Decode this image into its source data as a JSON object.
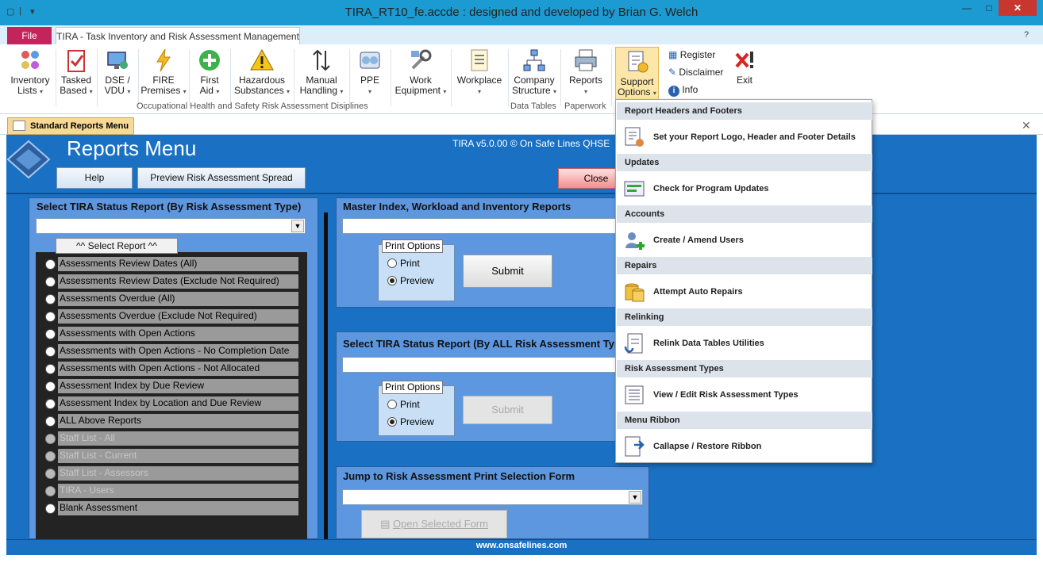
{
  "window": {
    "title": "TIRA_RT10_fe.accde : designed and developed by Brian G. Welch",
    "min": "—",
    "max": "□",
    "close": "✕"
  },
  "tabs": {
    "file": "File",
    "app": "TIRA - Task Inventory and Risk Assessment Management"
  },
  "ribbon": {
    "buttons": [
      {
        "l1": "Inventory",
        "l2": "Lists",
        "dd": true
      },
      {
        "l1": "Tasked",
        "l2": "Based",
        "dd": true
      },
      {
        "l1": "DSE /",
        "l2": "VDU",
        "dd": true
      },
      {
        "l1": "FIRE",
        "l2": "Premises",
        "dd": true
      },
      {
        "l1": "First",
        "l2": "Aid",
        "dd": true
      },
      {
        "l1": "Hazardous",
        "l2": "Substances",
        "dd": true
      },
      {
        "l1": "Manual",
        "l2": "Handling",
        "dd": true
      },
      {
        "l1": "PPE",
        "l2": "",
        "dd": true
      },
      {
        "l1": "Work",
        "l2": "Equipment",
        "dd": true
      },
      {
        "l1": "Workplace",
        "l2": "",
        "dd": true
      },
      {
        "l1": "Company",
        "l2": "Structure",
        "dd": true
      },
      {
        "l1": "Reports",
        "l2": "",
        "dd": true
      },
      {
        "l1": "Support",
        "l2": "Options",
        "dd": true
      }
    ],
    "group_ohs": "Occupational Health and Safety Risk Assessment Disiplines",
    "group_data": "Data Tables",
    "group_paper": "Paperwork",
    "register": "Register",
    "disclaimer": "Disclaimer",
    "info": "Info",
    "exit": "Exit",
    "dd_arrow": "▾"
  },
  "doc_tab": "Standard Reports Menu",
  "form": {
    "title": "Reports Menu",
    "version": "TIRA v5.0.00 © On Safe Lines QHSE",
    "help": "Help",
    "preview": "Preview Risk Assessment Spread",
    "close": "Close",
    "footer": "www.onsafelines.com"
  },
  "left_panel": {
    "title": "Select TIRA Status Report (By Risk Assessment Type)",
    "select_btn": "^^ Select Report ^^",
    "items": [
      {
        "label": "Assessments Review Dates (All)",
        "enabled": true
      },
      {
        "label": "Assessments Review Dates (Exclude Not Required)",
        "enabled": true
      },
      {
        "label": "Assessments Overdue (All)",
        "enabled": true
      },
      {
        "label": "Assessments Overdue (Exclude Not Required)",
        "enabled": true
      },
      {
        "label": "Assessments with Open Actions",
        "enabled": true
      },
      {
        "label": "Assessments with Open Actions - No Completion Date",
        "enabled": true
      },
      {
        "label": "Assessments with Open Actions - Not Allocated",
        "enabled": true
      },
      {
        "label": "Assessment Index by Due Review",
        "enabled": true
      },
      {
        "label": "Assessment Index by Location and Due Review",
        "enabled": true
      },
      {
        "label": "ALL Above Reports",
        "enabled": true
      },
      {
        "label": "Staff List - All",
        "enabled": false
      },
      {
        "label": "Staff List - Current",
        "enabled": false
      },
      {
        "label": "Staff List - Assessors",
        "enabled": false
      },
      {
        "label": "TIRA - Users",
        "enabled": false
      },
      {
        "label": "Blank Assessment",
        "enabled": true
      }
    ]
  },
  "master_panel": {
    "title": "Master Index, Workload and Inventory Reports",
    "options_label": "Print Options",
    "print": "Print",
    "preview": "Preview",
    "submit": "Submit",
    "selected": "Preview"
  },
  "all_panel": {
    "title": "Select TIRA Status Report (By ALL Risk Assessment Typ",
    "options_label": "Print Options",
    "print": "Print",
    "preview": "Preview",
    "submit": "Submit",
    "selected": "Preview"
  },
  "jump_panel": {
    "title": "Jump to Risk Assessment Print Selection Form",
    "open_btn": "Open Selected Form"
  },
  "support_menu": {
    "sections": [
      {
        "header": "Report Headers and Footers",
        "item": "Set your Report Logo, Header and Footer Details",
        "icon": "report-settings-icon"
      },
      {
        "header": "Updates",
        "item": "Check for Program Updates",
        "icon": "update-icon"
      },
      {
        "header": "Accounts",
        "item": "Create / Amend Users",
        "icon": "add-user-icon"
      },
      {
        "header": "Repairs",
        "item": "Attempt Auto Repairs",
        "icon": "database-icon"
      },
      {
        "header": "Relinking",
        "item": "Relink Data Tables Utilities",
        "icon": "link-document-icon"
      },
      {
        "header": "Risk Assessment Types",
        "item": "View / Edit Risk Assessment Types",
        "icon": "list-icon"
      },
      {
        "header": "Menu Ribbon",
        "item": "Callapse / Restore Ribbon",
        "icon": "collapse-icon"
      }
    ]
  },
  "colors": {
    "accent": "#1a71c3",
    "titlebar": "#1b9bd1",
    "file_tab": "#c4245c",
    "panel": "#5d97df"
  }
}
